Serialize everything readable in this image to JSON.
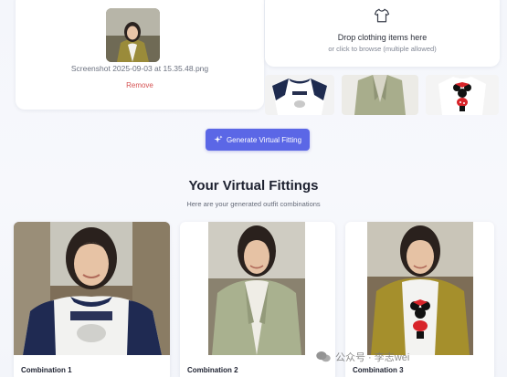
{
  "upload": {
    "filename": "Screenshot 2025-09-03 at 15.35.48.png",
    "remove_label": "Remove"
  },
  "dropzone": {
    "title": "Drop clothing items here",
    "subtitle": "or click to browse (multiple allowed)",
    "icon": "shirt-icon"
  },
  "clothing_items": [
    {
      "name": "snoopy-raglan-tee"
    },
    {
      "name": "sage-blazer"
    },
    {
      "name": "minnie-tee"
    }
  ],
  "generate_button": {
    "label": "Generate Virtual Fitting",
    "icon": "sparkle-icon",
    "color": "#5b67e6"
  },
  "results": {
    "title": "Your Virtual Fittings",
    "subtitle": "Here are your generated outfit combinations",
    "items": [
      {
        "label": "Combination 1"
      },
      {
        "label": "Combination 2"
      },
      {
        "label": "Combination 3"
      }
    ]
  },
  "watermark": {
    "text": "公众号 · 李志wei"
  }
}
